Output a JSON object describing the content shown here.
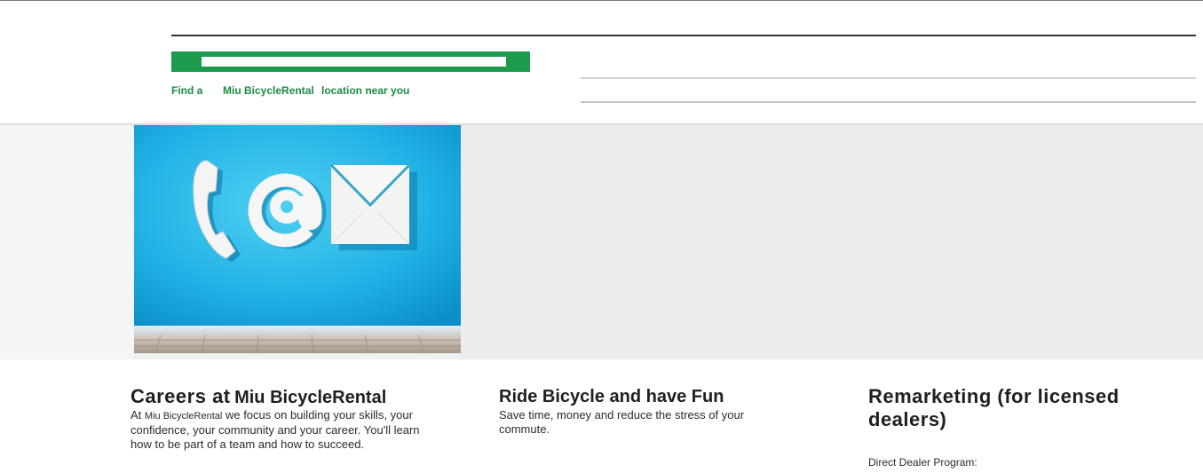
{
  "header": {
    "search": {
      "value": "",
      "placeholder": ""
    },
    "finder": {
      "part1": "Find a",
      "part2": "Miu BicycleRental",
      "part3": "location near you"
    }
  },
  "hero": {
    "image_icons": [
      "phone-icon",
      "at-sign-icon",
      "envelope-icon"
    ],
    "colors": {
      "wall": "#2bb5e6",
      "floor": "#b4a698",
      "panel": "#ececec"
    }
  },
  "columns": {
    "careers": {
      "title_part1": "Careers at",
      "title_part2": "Miu BicycleRental",
      "text_part1": "At",
      "text_part2": "Miu BicycleRental",
      "text_part3": "we focus on building your skills, your confidence, your community and your career. You'll learn how to be part of a team and how to succeed."
    },
    "ride": {
      "title": "Ride Bicycle and have Fun",
      "text": "Save time, money and reduce the stress of your commute."
    },
    "remarketing": {
      "title": "Remarketing (for licensed dealers)",
      "subtitle": "Direct Dealer Program:"
    }
  },
  "colors": {
    "brand_green": "#1c9a4d",
    "finder_text": "#1c8a45"
  }
}
